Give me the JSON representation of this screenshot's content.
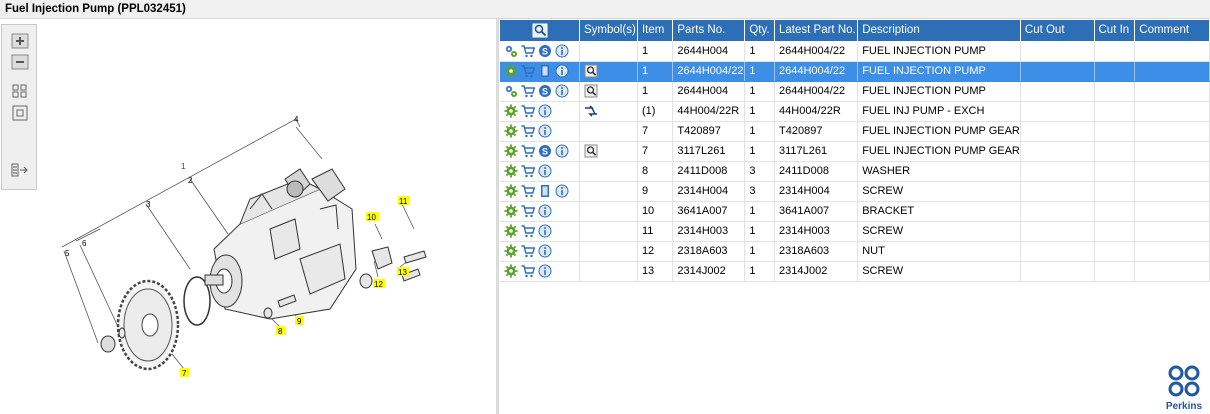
{
  "window": {
    "title": "Fuel Injection Pump (PPL032451)"
  },
  "toolbar": {
    "buttons": [
      {
        "name": "zoom-in-icon"
      },
      {
        "name": "zoom-out-icon"
      },
      {
        "name": "fit-all-icon"
      },
      {
        "name": "fit-window-icon"
      },
      {
        "name": "toggle-list-icon"
      }
    ]
  },
  "diagram": {
    "callouts": [
      "1",
      "2",
      "3",
      "4",
      "5",
      "6",
      "7",
      "8",
      "9",
      "10",
      "11",
      "12",
      "13"
    ]
  },
  "table": {
    "columns": [
      "",
      "Symbol(s)",
      "Item",
      "Parts No.",
      "Qty.",
      "Latest Part No.",
      "Description",
      "Cut Out",
      "Cut In",
      "Comment"
    ],
    "rows": [
      {
        "icons": [
          "gears-icon",
          "cart-icon",
          "s-icon",
          "info-icon"
        ],
        "symbol": "",
        "item": "1",
        "parts_no": "2644H004",
        "qty": "1",
        "latest": "2644H004/22",
        "desc": "FUEL INJECTION PUMP",
        "selected": false
      },
      {
        "icons": [
          "gear-icon",
          "cart-icon",
          "book-icon",
          "info-icon"
        ],
        "symbol": "magnifier-icon",
        "item": "1",
        "parts_no": "2644H004/22",
        "qty": "1",
        "latest": "2644H004/22",
        "desc": "FUEL INJECTION PUMP",
        "selected": true
      },
      {
        "icons": [
          "gears-icon",
          "cart-icon",
          "s-icon",
          "info-icon"
        ],
        "symbol": "magnifier-icon",
        "item": "1",
        "parts_no": "2644H004",
        "qty": "1",
        "latest": "2644H004/22",
        "desc": "FUEL INJECTION PUMP",
        "selected": false
      },
      {
        "icons": [
          "gear-icon",
          "cart-icon",
          "info-icon"
        ],
        "symbol": "exchange-icon",
        "item": "(1)",
        "parts_no": "44H004/22R",
        "qty": "1",
        "latest": "44H004/22R",
        "desc": "FUEL INJ PUMP - EXCH",
        "selected": false
      },
      {
        "icons": [
          "gear-icon",
          "cart-icon",
          "info-icon"
        ],
        "symbol": "",
        "item": "7",
        "parts_no": "T420897",
        "qty": "1",
        "latest": "T420897",
        "desc": "FUEL INJECTION PUMP GEAR",
        "selected": false
      },
      {
        "icons": [
          "gear-icon",
          "cart-icon",
          "s-icon",
          "info-icon"
        ],
        "symbol": "magnifier-icon",
        "item": "7",
        "parts_no": "3117L261",
        "qty": "1",
        "latest": "3117L261",
        "desc": "FUEL INJECTION PUMP GEAR",
        "selected": false
      },
      {
        "icons": [
          "gear-icon",
          "cart-icon",
          "info-icon"
        ],
        "symbol": "",
        "item": "8",
        "parts_no": "2411D008",
        "qty": "3",
        "latest": "2411D008",
        "desc": "WASHER",
        "selected": false
      },
      {
        "icons": [
          "gear-icon",
          "cart-icon",
          "book-icon",
          "info-icon"
        ],
        "symbol": "",
        "item": "9",
        "parts_no": "2314H004",
        "qty": "3",
        "latest": "2314H004",
        "desc": "SCREW",
        "selected": false
      },
      {
        "icons": [
          "gear-icon",
          "cart-icon",
          "info-icon"
        ],
        "symbol": "",
        "item": "10",
        "parts_no": "3641A007",
        "qty": "1",
        "latest": "3641A007",
        "desc": "BRACKET",
        "selected": false
      },
      {
        "icons": [
          "gear-icon",
          "cart-icon",
          "info-icon"
        ],
        "symbol": "",
        "item": "11",
        "parts_no": "2314H003",
        "qty": "1",
        "latest": "2314H003",
        "desc": "SCREW",
        "selected": false
      },
      {
        "icons": [
          "gear-icon",
          "cart-icon",
          "info-icon"
        ],
        "symbol": "",
        "item": "12",
        "parts_no": "2318A603",
        "qty": "1",
        "latest": "2318A603",
        "desc": "NUT",
        "selected": false
      },
      {
        "icons": [
          "gear-icon",
          "cart-icon",
          "info-icon"
        ],
        "symbol": "",
        "item": "13",
        "parts_no": "2314J002",
        "qty": "1",
        "latest": "2314J002",
        "desc": "SCREW",
        "selected": false
      }
    ]
  },
  "brand": {
    "name": "Perkins",
    "color": "#1f57a3"
  },
  "colors": {
    "header": "#2c6fb7",
    "selection": "#3d8ee6",
    "callout": "#ffff00",
    "gear_icon": "#5aa02c",
    "cart_icon": "#2f6fc0"
  }
}
